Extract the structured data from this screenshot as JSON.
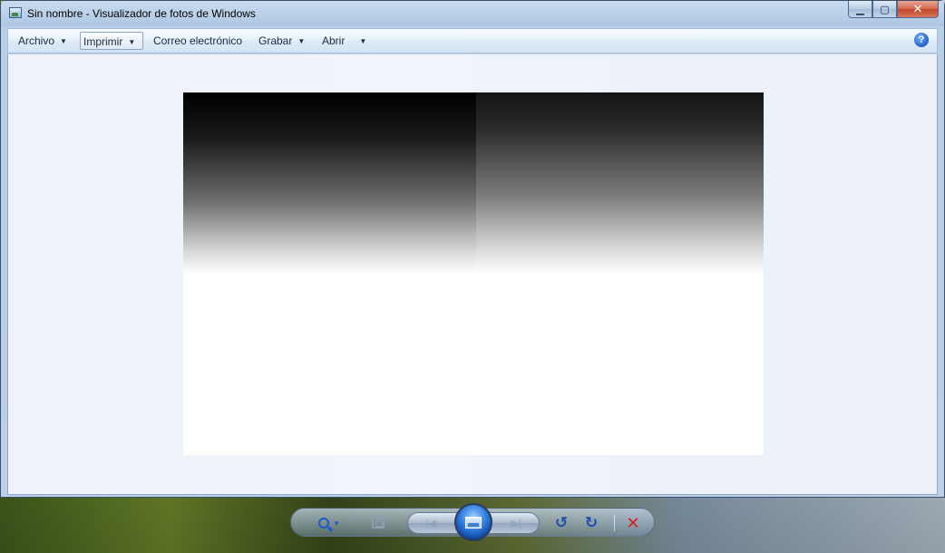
{
  "window": {
    "title": "Sin nombre - Visualizador de fotos de Windows",
    "min_glyph": "▁",
    "max_glyph": "▢",
    "close_glyph": "✕"
  },
  "menu": {
    "items": [
      {
        "label": "Archivo",
        "dropdown": true
      },
      {
        "label": "Imprimir",
        "dropdown": true
      },
      {
        "label": "Correo electrónico",
        "dropdown": false
      },
      {
        "label": "Grabar",
        "dropdown": true
      },
      {
        "label": "Abrir",
        "dropdown": true
      }
    ],
    "arrow_glyph": "▼",
    "help_glyph": "?"
  },
  "controls": {
    "zoom_dropdown_glyph": "▼",
    "prev_glyph": "|◀",
    "next_glyph": "▶|",
    "rotate_left_glyph": "↺",
    "rotate_right_glyph": "↻",
    "delete_glyph": "✕"
  },
  "colors": {
    "accent": "#1b5cc4",
    "delete": "#d42020"
  }
}
